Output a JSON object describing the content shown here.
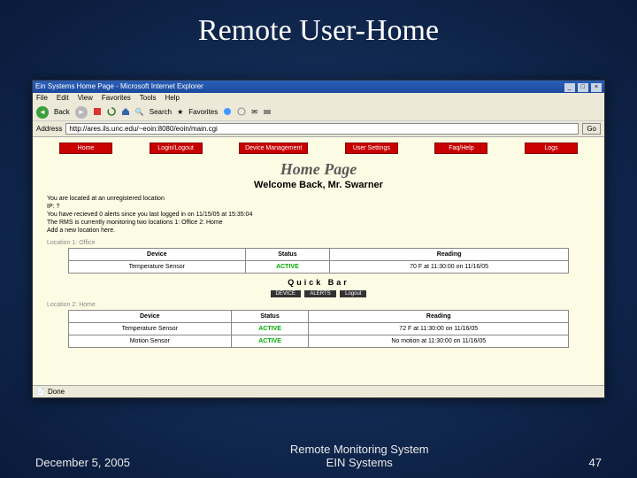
{
  "slide": {
    "title": "Remote User-Home",
    "date": "December 5, 2005",
    "footer_center_line1": "Remote Monitoring System",
    "footer_center_line2": "EIN Systems",
    "number": "47"
  },
  "browser": {
    "title": "Ein Systems Home Page - Microsoft Internet Explorer",
    "menubar": [
      "File",
      "Edit",
      "View",
      "Favorites",
      "Tools",
      "Help"
    ],
    "toolbar": {
      "back": "Back",
      "search": "Search",
      "favorites": "Favorites"
    },
    "address_label": "Address",
    "address_value": "http://ares.ils.unc.edu/~eoin:8080/eoin/main.cgi",
    "go": "Go",
    "status": "Done"
  },
  "page": {
    "nav": [
      {
        "label": "Home"
      },
      {
        "label": "Login/Logout"
      },
      {
        "label": "Device Management"
      },
      {
        "label": "User Settings"
      },
      {
        "label": "Faq/Help"
      },
      {
        "label": "Logs"
      }
    ],
    "heading": "Home Page",
    "welcome": "Welcome Back, Mr. Swarner",
    "info_lines": [
      "You are located at an unregistered location",
      "IP: ?",
      "You have recieved 0 alerts since you last logged in on 11/15/05 at 15:35:04",
      "The RMS is currently monitoring two locations 1: Office 2: Home",
      "Add a new location here."
    ],
    "quickbar_label": "Quick Bar",
    "quickbar_buttons": [
      "DEVICE",
      "ALERTS",
      "Logout"
    ],
    "locations": [
      {
        "title": "Location 1: Office",
        "headers": [
          "Device",
          "Status",
          "Reading"
        ],
        "rows": [
          {
            "device": "Temperature Sensor",
            "status": "ACTIVE",
            "reading": "70 F at 11:30:00 on 11/16/05"
          }
        ]
      },
      {
        "title": "Location 2: Home",
        "headers": [
          "Device",
          "Status",
          "Reading"
        ],
        "rows": [
          {
            "device": "Temperature Sensor",
            "status": "ACTIVE",
            "reading": "72 F at 11:30:00 on 11/16/05"
          },
          {
            "device": "Motion Sensor",
            "status": "ACTIVE",
            "reading": "No motion at 11:30:00 on 11/16/05"
          }
        ]
      }
    ]
  }
}
